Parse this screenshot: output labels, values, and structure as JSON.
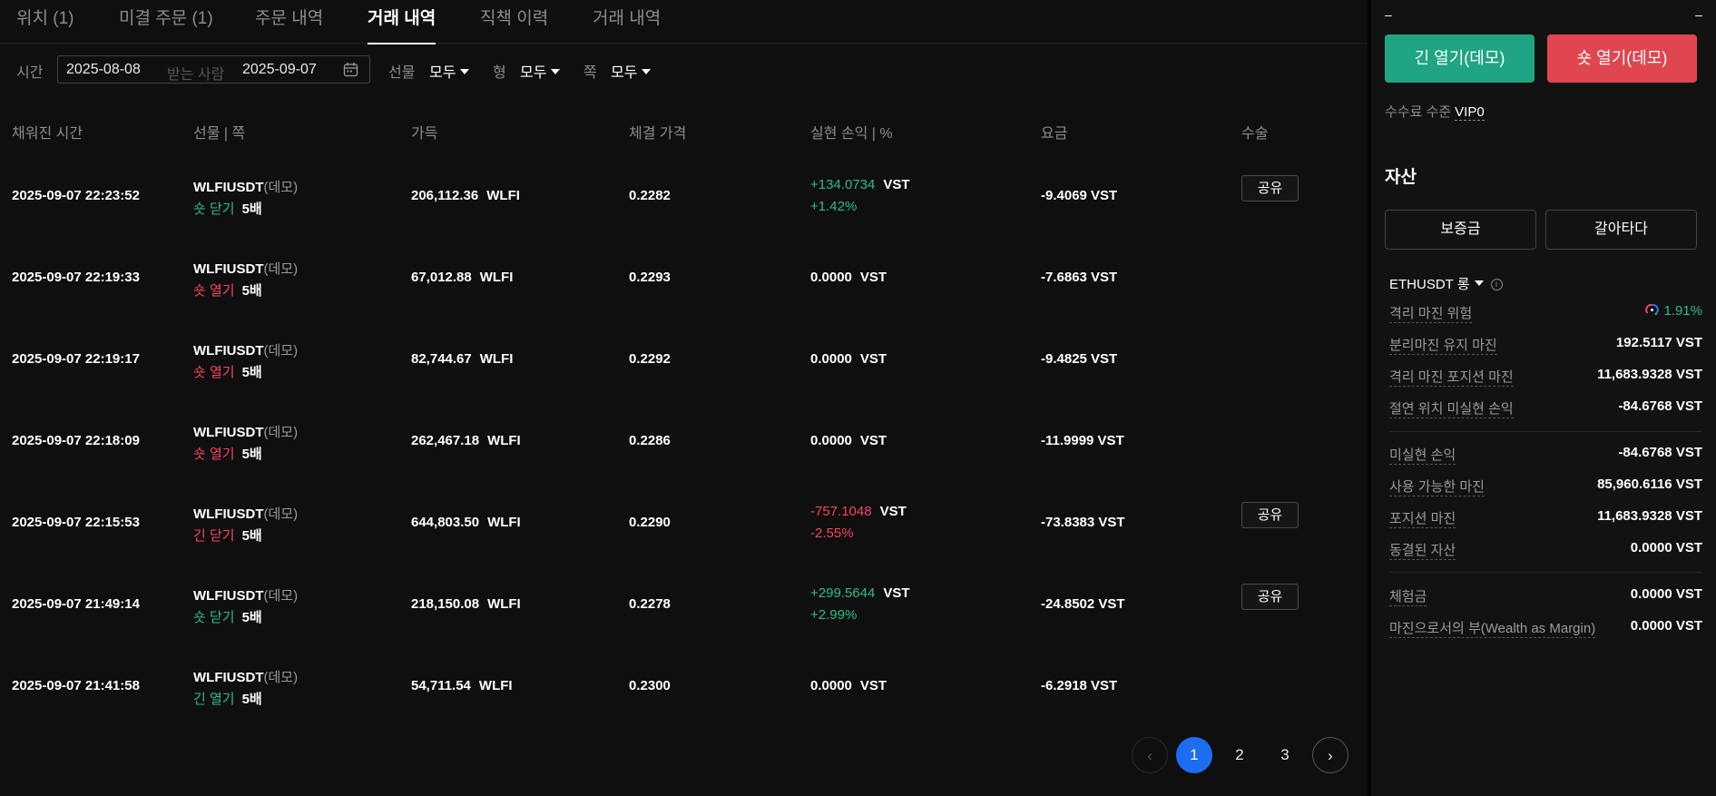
{
  "tabs": [
    "위치 (1)",
    "미결 주문 (1)",
    "주문 내역",
    "거래 내역",
    "직책 이력",
    "거래 내역"
  ],
  "filters": {
    "time_label": "시간",
    "date_from": "2025-08-08",
    "date_sep": "받는 사람",
    "date_to": "2025-09-07",
    "futures_label": "선물",
    "futures_value": "모두",
    "type_label": "형",
    "type_value": "모두",
    "side_label": "쪽",
    "side_value": "모두"
  },
  "columns": [
    "채워진 시간",
    "선물 | 쪽",
    "가득",
    "체결 가격",
    "실현 손익 | %",
    "요금",
    "수술"
  ],
  "rows": [
    {
      "time": "2025-09-07 22:23:52",
      "symbol": "WLFIUSDT",
      "demo": "(데모)",
      "side": "숏 닫기",
      "side_color": "#2ebd85",
      "leverage": "5배",
      "qty": "206,112.36",
      "qty_unit": "WLFI",
      "price": "0.2282",
      "pnl": "+134.0734",
      "pnl_pct": "+1.42%",
      "pnl_color": "#2ebd85",
      "pnl_unit": "VST",
      "fee": "-9.4069 VST",
      "share": "공유"
    },
    {
      "time": "2025-09-07 22:19:33",
      "symbol": "WLFIUSDT",
      "demo": "(데모)",
      "side": "숏 열기",
      "side_color": "#f6465d",
      "leverage": "5배",
      "qty": "67,012.88",
      "qty_unit": "WLFI",
      "price": "0.2293",
      "pnl": "0.0000",
      "pnl_pct": "",
      "pnl_color": "#ffffff",
      "pnl_unit": "VST",
      "fee": "-7.6863 VST",
      "share": ""
    },
    {
      "time": "2025-09-07 22:19:17",
      "symbol": "WLFIUSDT",
      "demo": "(데모)",
      "side": "숏 열기",
      "side_color": "#f6465d",
      "leverage": "5배",
      "qty": "82,744.67",
      "qty_unit": "WLFI",
      "price": "0.2292",
      "pnl": "0.0000",
      "pnl_pct": "",
      "pnl_color": "#ffffff",
      "pnl_unit": "VST",
      "fee": "-9.4825 VST",
      "share": ""
    },
    {
      "time": "2025-09-07 22:18:09",
      "symbol": "WLFIUSDT",
      "demo": "(데모)",
      "side": "숏 열기",
      "side_color": "#f6465d",
      "leverage": "5배",
      "qty": "262,467.18",
      "qty_unit": "WLFI",
      "price": "0.2286",
      "pnl": "0.0000",
      "pnl_pct": "",
      "pnl_color": "#ffffff",
      "pnl_unit": "VST",
      "fee": "-11.9999 VST",
      "share": ""
    },
    {
      "time": "2025-09-07 22:15:53",
      "symbol": "WLFIUSDT",
      "demo": "(데모)",
      "side": "긴 닫기",
      "side_color": "#f6465d",
      "leverage": "5배",
      "qty": "644,803.50",
      "qty_unit": "WLFI",
      "price": "0.2290",
      "pnl": "-757.1048",
      "pnl_pct": "-2.55%",
      "pnl_color": "#f6465d",
      "pnl_unit": "VST",
      "fee": "-73.8383 VST",
      "share": "공유"
    },
    {
      "time": "2025-09-07 21:49:14",
      "symbol": "WLFIUSDT",
      "demo": "(데모)",
      "side": "숏 닫기",
      "side_color": "#2ebd85",
      "leverage": "5배",
      "qty": "218,150.08",
      "qty_unit": "WLFI",
      "price": "0.2278",
      "pnl": "+299.5644",
      "pnl_pct": "+2.99%",
      "pnl_color": "#2ebd85",
      "pnl_unit": "VST",
      "fee": "-24.8502 VST",
      "share": "공유"
    },
    {
      "time": "2025-09-07 21:41:58",
      "symbol": "WLFIUSDT",
      "demo": "(데모)",
      "side": "긴 열기",
      "side_color": "#2ebd85",
      "leverage": "5배",
      "qty": "54,711.54",
      "qty_unit": "WLFI",
      "price": "0.2300",
      "pnl": "0.0000",
      "pnl_pct": "",
      "pnl_color": "#ffffff",
      "pnl_unit": "VST",
      "fee": "-6.2918 VST",
      "share": ""
    }
  ],
  "pagination": {
    "prev": "‹",
    "pages": [
      "1",
      "2",
      "3"
    ],
    "current": "1",
    "next": "›"
  },
  "panel": {
    "dash_left": "–",
    "dash_right": "–",
    "open_long": "긴 열기(데모)",
    "open_short": "숏 열기(데모)",
    "fee_level_label": "수수료 수준",
    "fee_level_value": "VIP0",
    "assets_title": "자산",
    "btn_margin": "보증금",
    "btn_transfer": "갈아타다",
    "symbol": "ETHUSDT 롱",
    "group1": [
      {
        "k": "격리 마진 위험",
        "v": "1.91%",
        "green": true
      },
      {
        "k": "분리마진 유지 마진",
        "v": "192.5117 VST"
      },
      {
        "k": "격리 마진 포지션 마진",
        "v": "11,683.9328 VST"
      },
      {
        "k": "절연 위치 미실현 손익",
        "v": "-84.6768 VST"
      }
    ],
    "group2": [
      {
        "k": "미실현 손익",
        "v": "-84.6768 VST"
      },
      {
        "k": "사용 가능한 마진",
        "v": "85,960.6116 VST"
      },
      {
        "k": "포지션 마진",
        "v": "11,683.9328 VST"
      },
      {
        "k": "동결된 자산",
        "v": "0.0000 VST"
      }
    ],
    "group3": [
      {
        "k": "체험금",
        "v": "0.0000 VST"
      },
      {
        "k": "마진으로서의 부(Wealth as Margin)",
        "v": "0.0000 VST"
      }
    ]
  }
}
